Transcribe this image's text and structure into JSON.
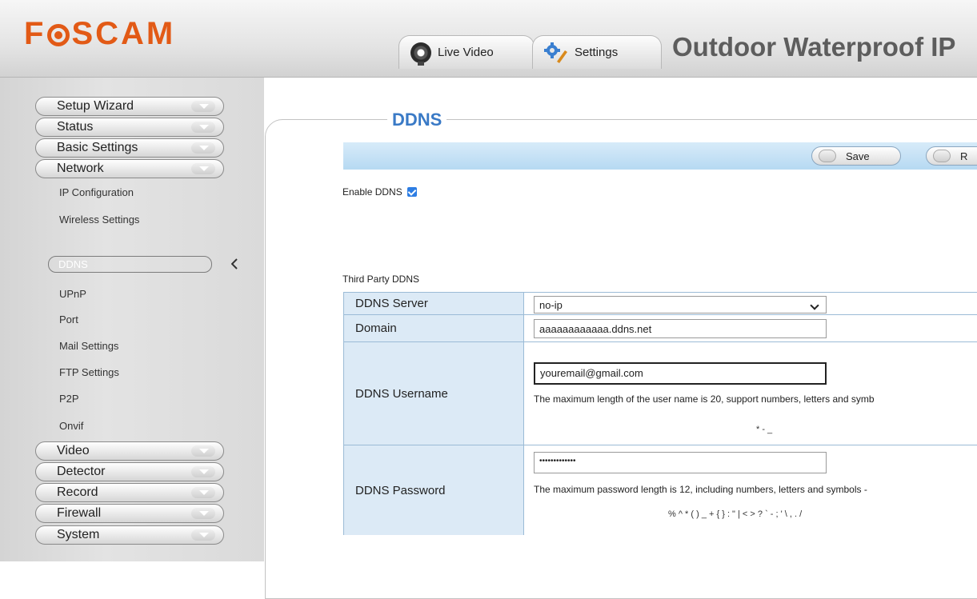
{
  "header": {
    "logo": "FOSCAM",
    "tabs": [
      {
        "label": "Live Video",
        "icon": "camera-icon"
      },
      {
        "label": "Settings",
        "icon": "settings-icon"
      }
    ],
    "heading": "Outdoor Waterproof IP"
  },
  "sidebar": {
    "menu_top": [
      "Setup Wizard",
      "Status",
      "Basic Settings",
      "Network"
    ],
    "network_items": [
      "IP Configuration",
      "Wireless Settings",
      "DDNS",
      "UPnP",
      "Port",
      "Mail Settings",
      "FTP Settings",
      "P2P",
      "Onvif"
    ],
    "active_item": "DDNS",
    "menu_bottom": [
      "Video",
      "Detector",
      "Record",
      "Firewall",
      "System"
    ]
  },
  "main": {
    "title": "DDNS",
    "toolbar": {
      "save": "Save",
      "refresh": "R"
    },
    "enable_label": "Enable DDNS",
    "enable_checked": true,
    "section_label": "Third Party DDNS",
    "rows": {
      "server": {
        "label": "DDNS Server",
        "value": "no-ip"
      },
      "domain": {
        "label": "Domain",
        "value": "aaaaaaaaaaaa.ddns.net"
      },
      "username": {
        "label": "DDNS Username",
        "value": "youremail@gmail.com",
        "hint": "The maximum length of the user name is 20, support numbers, letters and symb",
        "symbols": "* - _"
      },
      "password": {
        "label": "DDNS Password",
        "value": "•••••••••••••",
        "hint": "The maximum password length is 12, including numbers, letters and symbols -",
        "symbols": "% ^ * ( ) _ + { } : \" | < > ? ` - ; ' \\ , . /"
      }
    }
  },
  "colors": {
    "brand": "#e25a16",
    "accent": "#3a7ac6",
    "label_bg": "#dceaf6",
    "checkbox": "#2d7de3"
  }
}
